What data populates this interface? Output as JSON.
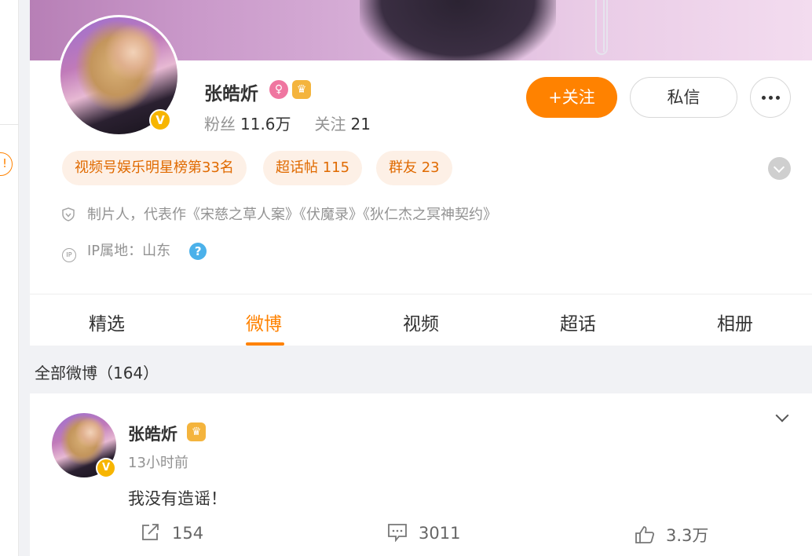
{
  "sidebar": {
    "badge_glyph": "!"
  },
  "profile": {
    "name": "张皓炘",
    "verified_glyph": "V",
    "stats": {
      "fans_label": "粉丝",
      "fans_value": "11.6万",
      "follow_label": "关注",
      "follow_value": "21"
    },
    "buttons": {
      "follow": "+关注",
      "message": "私信"
    },
    "tags": [
      "视频号娱乐明星榜第33名",
      "超话帖 115",
      "群友 23"
    ],
    "bio": "制片人，代表作《宋慈之草人案》《伏魔录》《狄仁杰之冥神契约》",
    "ip_icon_text": "IP",
    "ip_location": "IP属地：山东",
    "help_glyph": "?"
  },
  "tabs": [
    "精选",
    "微博",
    "视频",
    "超话",
    "相册"
  ],
  "active_tab": "微博",
  "section": {
    "title": "全部微博（164）"
  },
  "post": {
    "author": "张皓炘",
    "time": "13小时前",
    "text": "我没有造谣！",
    "reposts": "154",
    "comments": "3011",
    "likes": "3.3万"
  },
  "colors": {
    "accent": "#ff8200",
    "tag_bg": "#fdf0e6",
    "verified": "#f7b500",
    "help_icon": "#4bb1ea"
  }
}
